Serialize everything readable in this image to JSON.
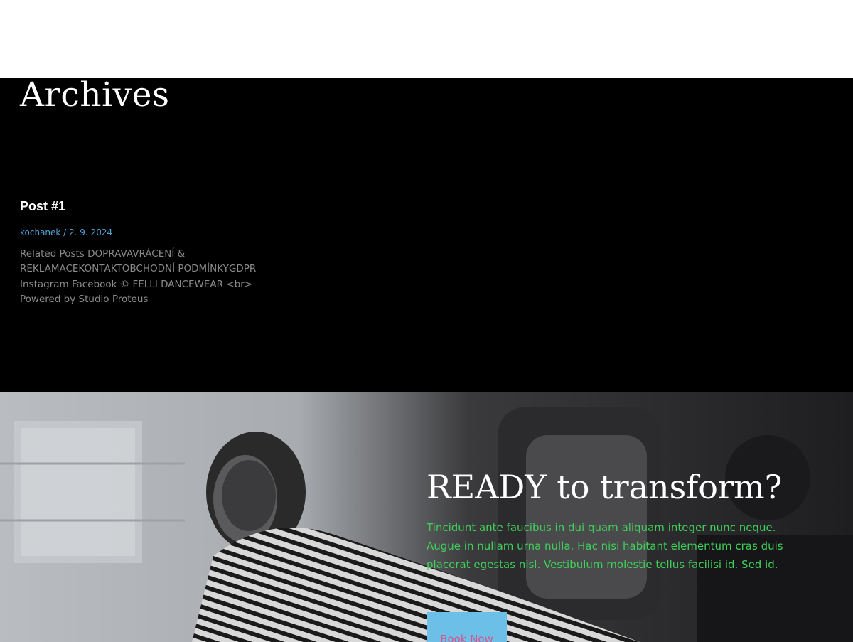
{
  "archive": {
    "title": "Archives"
  },
  "post": {
    "title": "Post #1",
    "author": "kochanek",
    "separator": " / ",
    "date": "2. 9. 2024",
    "excerpt": "Related Posts DOPRAVAVRÁCENÍ & REKLAMACEKONTAKTOBCHODNÍ PODMÍNKYGDPR Instagram  Facebook © FELLI DANCEWEAR <br> Powered by Studio Proteus"
  },
  "cta": {
    "heading": "READY to transform?",
    "text": "Tincidunt ante faucibus in dui quam aliquam integer nunc neque. Augue in nullam urna nulla. Hac nisi habitant elementum cras duis placerat egestas nisl. Vestibulum molestie tellus facilisi id. Sed id.",
    "button_label": "Book Now"
  },
  "colors": {
    "archive_bg": "#000000",
    "meta_link": "#4fa3d8",
    "cta_text": "#3fcf5a",
    "button_bg": "#6cc0e8",
    "button_text": "#d9538b"
  }
}
